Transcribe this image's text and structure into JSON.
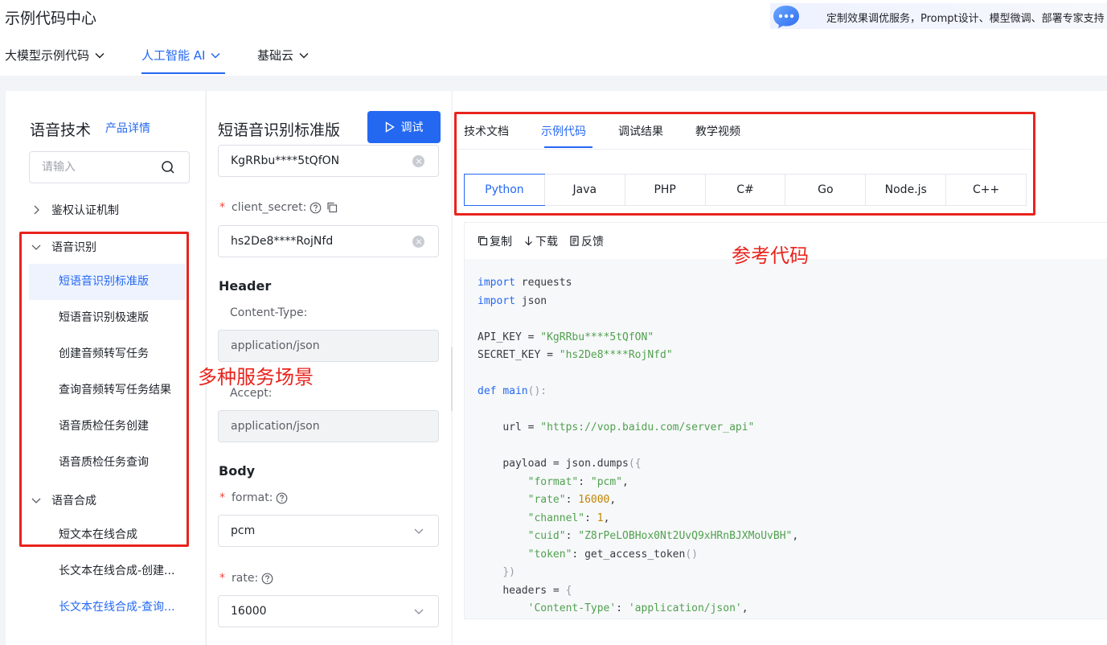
{
  "header": {
    "title": "示例代码中心",
    "promo_text": "定制效果调优服务，Prompt设计、模型微调、部署专家支持",
    "nav": [
      {
        "label": "大模型示例代码"
      },
      {
        "label": "人工智能 AI"
      },
      {
        "label": "基础云"
      }
    ]
  },
  "sidebar": {
    "title": "语音技术",
    "detail_link": "产品详情",
    "search_placeholder": "请输入",
    "groups": [
      {
        "label": "鉴权认证机制"
      },
      {
        "label": "语音识别"
      },
      {
        "label": "语音合成"
      }
    ],
    "items": [
      {
        "label": "短语音识别标准版"
      },
      {
        "label": "短语音识别极速版"
      },
      {
        "label": "创建音频转写任务"
      },
      {
        "label": "查询音频转写任务结果"
      },
      {
        "label": "语音质检任务创建"
      },
      {
        "label": "语音质检任务查询"
      },
      {
        "label": "短文本在线合成"
      },
      {
        "label": "长文本在线合成-创建..."
      },
      {
        "label": "长文本在线合成-查询..."
      }
    ]
  },
  "params": {
    "title": "短语音识别标准版",
    "debug_label": "调试",
    "client_id_value": "KgRRbu****5tQfON",
    "client_secret_label": "client_secret:",
    "client_secret_value": "hs2De8****RojNfd",
    "header_section": "Header",
    "content_type_label": "Content-Type:",
    "content_type_value": "application/json",
    "accept_label": "Accept:",
    "accept_value": "application/json",
    "body_section": "Body",
    "format_label": "format:",
    "format_value": "pcm",
    "rate_label": "rate:",
    "rate_value": "16000"
  },
  "code_panel": {
    "tabs": [
      {
        "label": "技术文档"
      },
      {
        "label": "示例代码"
      },
      {
        "label": "调试结果"
      },
      {
        "label": "教学视频"
      }
    ],
    "languages": [
      "Python",
      "Java",
      "PHP",
      "C#",
      "Go",
      "Node.js",
      "C++"
    ],
    "selected_language": "Python",
    "toolbar": {
      "copy": "复制",
      "download": "下载",
      "feedback": "反馈"
    },
    "code": {
      "kw_import": "import",
      "mod_requests": "requests",
      "mod_json": "json",
      "api_key_name": "API_KEY",
      "api_key_value": "\"KgRRbu****5tQfON\"",
      "secret_key_name": "SECRET_KEY",
      "secret_key_value": "\"hs2De8****RojNfd\"",
      "kw_def": "def",
      "fn_main": "main",
      "url_name": "url",
      "url_value": "\"https://vop.baidu.com/server_api\"",
      "payload_name": "payload",
      "json_dumps": "json.dumps",
      "k_format": "\"format\"",
      "v_format": "\"pcm\"",
      "k_rate": "\"rate\"",
      "v_rate": "16000",
      "k_channel": "\"channel\"",
      "v_channel": "1",
      "k_cuid": "\"cuid\"",
      "v_cuid": "\"Z8rPeLOBHox0Nt2UvQ9xHRnBJXMoUvBH\"",
      "k_token": "\"token\"",
      "v_token": "get_access_token",
      "headers_name": "headers",
      "k_content_type": "'Content-Type'",
      "v_content_type": "'application/json'"
    }
  },
  "annotations": {
    "scenarios": "多种服务场景",
    "reference_code": "参考代码"
  },
  "colors": {
    "accent": "#2468f2",
    "annotation_red": "#e8241d"
  }
}
